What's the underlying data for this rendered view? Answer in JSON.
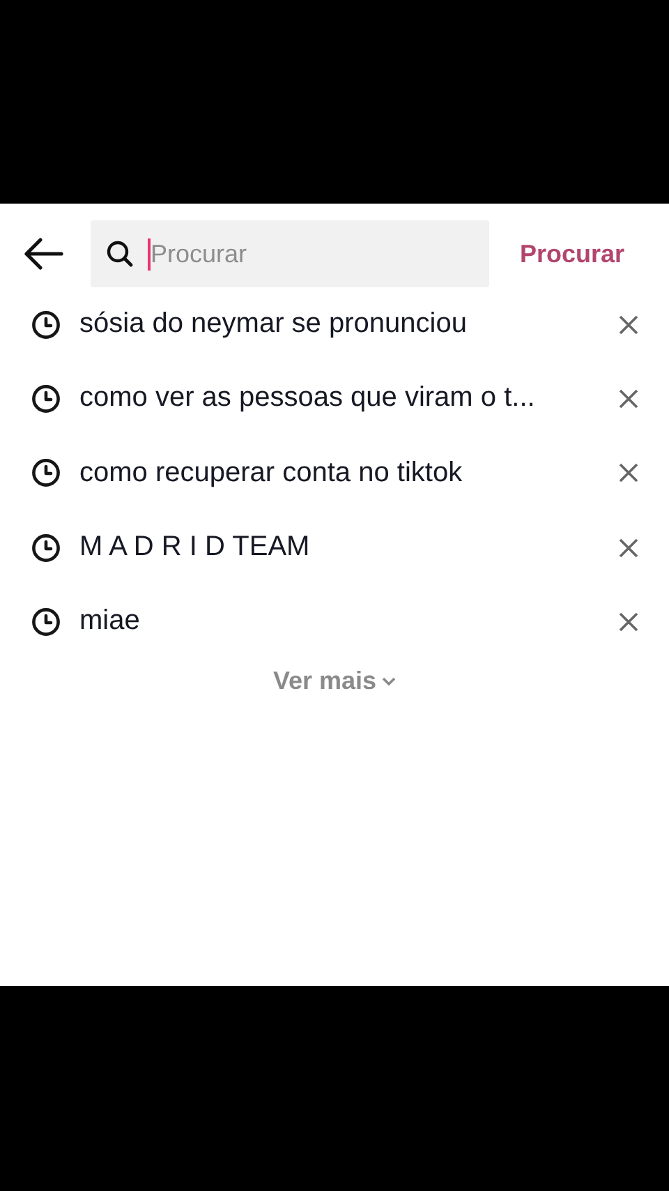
{
  "search": {
    "placeholder": "Procurar",
    "submit": "Procurar"
  },
  "history": [
    {
      "text": "sósia do neymar se pronunciou"
    },
    {
      "text": "como ver as pessoas que viram o t..."
    },
    {
      "text": "como recuperar conta no tiktok"
    },
    {
      "text": "M A D R I D TEAM"
    },
    {
      "text": "miae"
    }
  ],
  "more": "Ver mais"
}
